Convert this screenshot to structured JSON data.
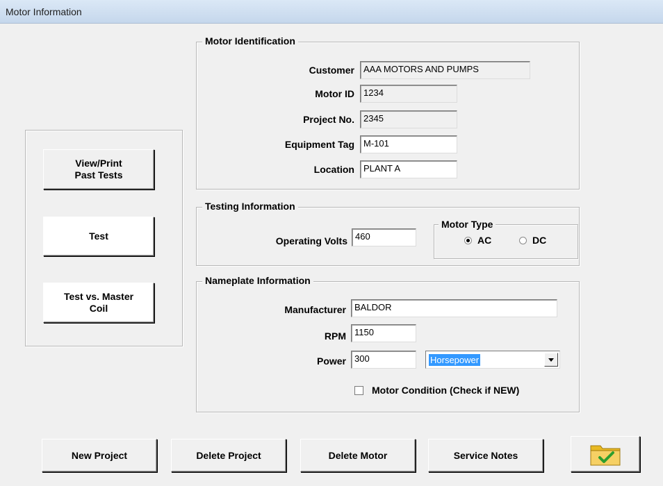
{
  "window": {
    "title": "Motor Information"
  },
  "motor_identification": {
    "legend": "Motor Identification",
    "customer": {
      "label": "Customer",
      "value": "AAA MOTORS AND PUMPS"
    },
    "motor_id": {
      "label": "Motor ID",
      "value": "1234"
    },
    "project_no": {
      "label": "Project No.",
      "value": "2345"
    },
    "equipment_tag": {
      "label": "Equipment Tag",
      "value": "M-101"
    },
    "location": {
      "label": "Location",
      "value": "PLANT A"
    }
  },
  "testing_information": {
    "legend": "Testing Information",
    "operating_volts": {
      "label": "Operating Volts",
      "value": "460"
    },
    "motor_type": {
      "legend": "Motor Type",
      "options": [
        "AC",
        "DC"
      ],
      "selected": "AC"
    }
  },
  "nameplate_information": {
    "legend": "Nameplate Information",
    "manufacturer": {
      "label": "Manufacturer",
      "value": "BALDOR"
    },
    "rpm": {
      "label": "RPM",
      "value": "1150"
    },
    "power": {
      "label": "Power",
      "value": "300",
      "unit": "Horsepower"
    },
    "motor_condition": {
      "label": "Motor Condition (Check if NEW)",
      "checked": false
    }
  },
  "side_buttons": {
    "view_print": "View/Print\nPast Tests",
    "test": "Test",
    "test_vs_master": "Test vs. Master\nCoil"
  },
  "bottom_buttons": {
    "new_project": "New Project",
    "delete_project": "Delete Project",
    "delete_motor": "Delete Motor",
    "service_notes": "Service Notes"
  },
  "colors": {
    "selection": "#3399ff",
    "folder": "#f2c94c",
    "check": "#2e9e2e"
  },
  "icons": {
    "ok": "folder-check-icon"
  }
}
